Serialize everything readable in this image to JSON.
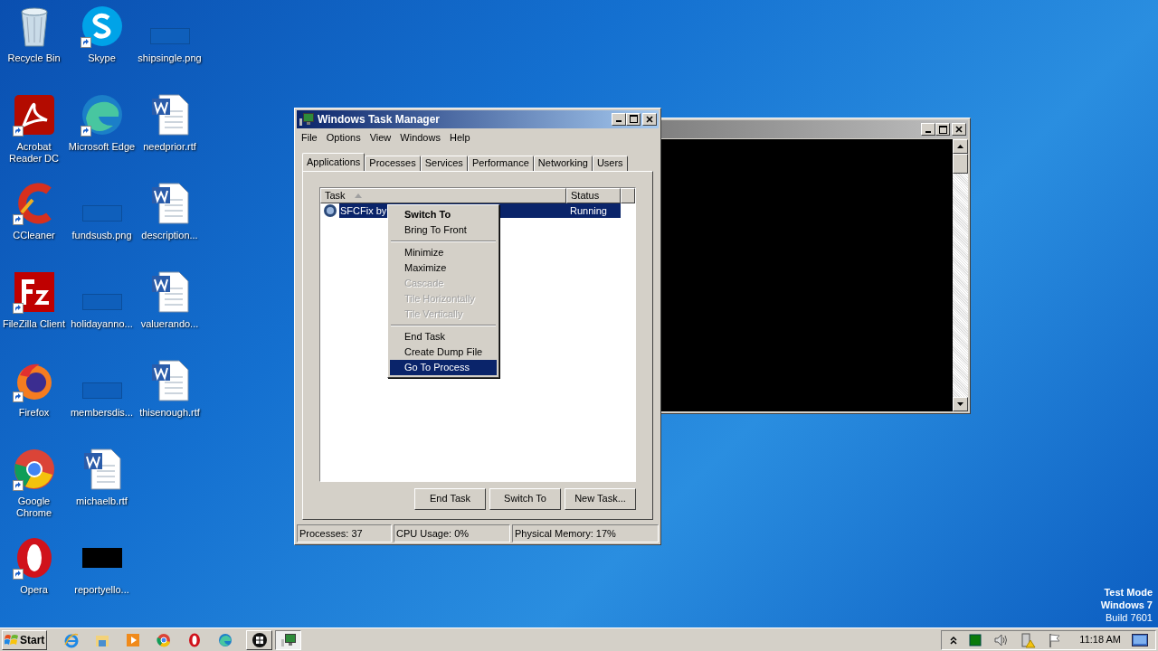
{
  "desktop_icons": [
    {
      "kind": "recycle-bin",
      "label": "Recycle Bin",
      "shortcut": false
    },
    {
      "kind": "pdf",
      "label": "Acrobat Reader DC",
      "shortcut": true
    },
    {
      "kind": "ccleaner",
      "label": "CCleaner",
      "shortcut": true
    },
    {
      "kind": "filezilla",
      "label": "FileZilla Client",
      "shortcut": true
    },
    {
      "kind": "firefox",
      "label": "Firefox",
      "shortcut": true
    },
    {
      "kind": "chrome",
      "label": "Google Chrome",
      "shortcut": true
    },
    {
      "kind": "opera",
      "label": "Opera",
      "shortcut": true
    },
    {
      "kind": "skype",
      "label": "Skype",
      "shortcut": true
    },
    {
      "kind": "edge",
      "label": "Microsoft Edge",
      "shortcut": true
    },
    {
      "kind": "image",
      "label": "fundsusb.png",
      "shortcut": false
    },
    {
      "kind": "image",
      "label": "holidayanno...",
      "shortcut": false
    },
    {
      "kind": "image",
      "label": "membersdis...",
      "shortcut": false
    },
    {
      "kind": "word",
      "label": "michaelb.rtf",
      "shortcut": false
    },
    {
      "kind": "black",
      "label": "reportyello...",
      "shortcut": false
    },
    {
      "kind": "image",
      "label": "shipsingle.png",
      "shortcut": false
    },
    {
      "kind": "word",
      "label": "needprior.rtf",
      "shortcut": false
    },
    {
      "kind": "word",
      "label": "description...",
      "shortcut": false
    },
    {
      "kind": "word",
      "label": "valuerando...",
      "shortcut": false
    },
    {
      "kind": "word",
      "label": "thisenough.rtf",
      "shortcut": false
    }
  ],
  "task_manager": {
    "title": "Windows Task Manager",
    "menu": [
      "File",
      "Options",
      "View",
      "Windows",
      "Help"
    ],
    "tabs": [
      {
        "label": "Applications",
        "selected": true
      },
      {
        "label": "Processes",
        "selected": false
      },
      {
        "label": "Services",
        "selected": false
      },
      {
        "label": "Performance",
        "selected": false
      },
      {
        "label": "Networking",
        "selected": false
      },
      {
        "label": "Users",
        "selected": false
      }
    ],
    "table": {
      "columns": [
        "Task",
        "Status"
      ],
      "rows": [
        {
          "task": "SFCFix by",
          "status": "Running",
          "selected": true
        }
      ]
    },
    "buttons": [
      "End Task",
      "Switch To",
      "New Task..."
    ],
    "status_bar": [
      "Processes: 37",
      "CPU Usage: 0%",
      "Physical Memory: 17%"
    ]
  },
  "context_menu": [
    {
      "kind": "item",
      "label": "Switch To",
      "default": true,
      "disabled": false,
      "selected": false
    },
    {
      "kind": "item",
      "label": "Bring To Front",
      "default": false,
      "disabled": false,
      "selected": false
    },
    {
      "kind": "separator"
    },
    {
      "kind": "item",
      "label": "Minimize",
      "default": false,
      "disabled": false,
      "selected": false
    },
    {
      "kind": "item",
      "label": "Maximize",
      "default": false,
      "disabled": false,
      "selected": false
    },
    {
      "kind": "item",
      "label": "Cascade",
      "default": false,
      "disabled": true,
      "selected": false
    },
    {
      "kind": "item",
      "label": "Tile Horizontally",
      "default": false,
      "disabled": true,
      "selected": false
    },
    {
      "kind": "item",
      "label": "Tile Vertically",
      "default": false,
      "disabled": true,
      "selected": false
    },
    {
      "kind": "separator"
    },
    {
      "kind": "item",
      "label": "End Task",
      "default": false,
      "disabled": false,
      "selected": false
    },
    {
      "kind": "item",
      "label": "Create Dump File",
      "default": false,
      "disabled": false,
      "selected": false
    },
    {
      "kind": "item",
      "label": "Go To Process",
      "default": false,
      "disabled": false,
      "selected": true
    }
  ],
  "desktop_note": [
    "Test Mode",
    "Windows 7",
    "Build 7601"
  ],
  "taskbar": {
    "start": "Start",
    "quick_launch": [
      {
        "kind": "ie"
      },
      {
        "kind": "explorer"
      },
      {
        "kind": "media"
      },
      {
        "kind": "chrome"
      },
      {
        "kind": "opera"
      },
      {
        "kind": "edge"
      }
    ],
    "tasks": [
      {
        "kind": "windows",
        "selected": false
      },
      {
        "kind": "taskmgr",
        "selected": true
      }
    ],
    "tray": [
      {
        "kind": "expand"
      },
      {
        "kind": "green"
      },
      {
        "kind": "volume"
      },
      {
        "kind": "network"
      },
      {
        "kind": "flag"
      }
    ],
    "clock": "11:18 AM"
  }
}
